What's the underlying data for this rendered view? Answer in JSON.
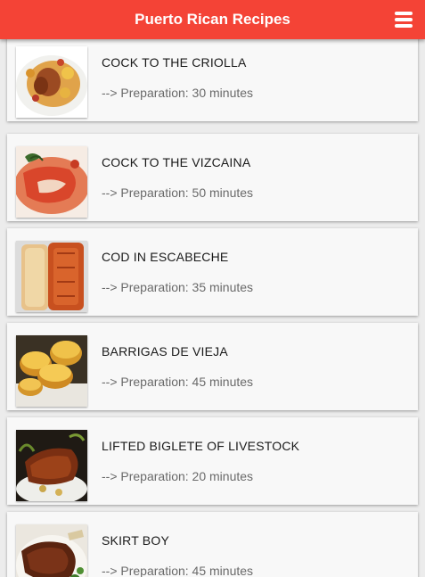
{
  "app": {
    "title": "Puerto Rican Recipes",
    "menu_icon": "hamburger-menu-icon",
    "accent_color": "#f44336"
  },
  "recipes": [
    {
      "title": "COCK TO THE CRIOLLA",
      "prep": "--> Preparation: 30 minutes",
      "image": "chicken-stew-photo"
    },
    {
      "title": "COCK TO THE VIZCAINA",
      "prep": "--> Preparation: 50 minutes",
      "image": "cod-tomato-sauce-photo"
    },
    {
      "title": "COD IN ESCABECHE",
      "prep": "--> Preparation: 35 minutes",
      "image": "cod-escabeche-photo"
    },
    {
      "title": "BARRIGAS DE VIEJA",
      "prep": "--> Preparation: 45 minutes",
      "image": "pumpkin-fritters-photo"
    },
    {
      "title": "LIFTED BIGLETE OF LIVESTOCK",
      "prep": "--> Preparation: 20 minutes",
      "image": "beef-steak-photo"
    },
    {
      "title": "SKIRT BOY",
      "prep": "--> Preparation: 45 minutes",
      "image": "skirt-steak-photo"
    }
  ]
}
